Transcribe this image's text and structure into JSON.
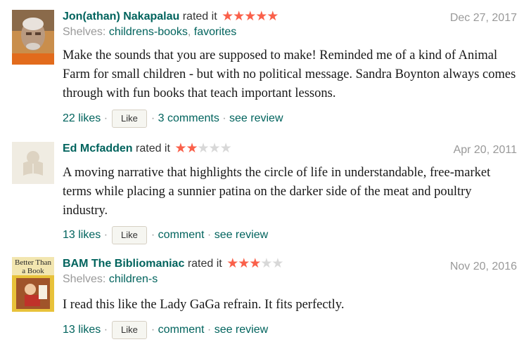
{
  "reviews": [
    {
      "user": "Jon(athan) Nakapalau",
      "rated_label": "rated it",
      "rating": 5,
      "date": "Dec 27, 2017",
      "shelves_label": "Shelves:",
      "shelves": [
        "childrens-books",
        "favorites"
      ],
      "text": "Make the sounds that you are supposed to make! Reminded me of a kind of Animal Farm for small children - but with no political message. Sandra Boynton always comes through with fun books that teach important lessons.",
      "likes": "22 likes",
      "like_button": "Like",
      "comments": "3 comments",
      "see_review": "see review"
    },
    {
      "user": "Ed Mcfadden",
      "rated_label": "rated it",
      "rating": 2,
      "date": "Apr 20, 2011",
      "text": "A moving narrative that highlights the circle of life in understandable, free-market terms while placing a sunnier patina on the darker side of the meat and poultry industry.",
      "likes": "13 likes",
      "like_button": "Like",
      "comments": "comment",
      "see_review": "see review"
    },
    {
      "user": "BAM The Bibliomaniac",
      "rated_label": "rated it",
      "rating": 3,
      "date": "Nov 20, 2016",
      "shelves_label": "Shelves:",
      "shelves": [
        "children-s"
      ],
      "avatar_text": "Better Than a Book",
      "text": "I read this like the Lady GaGa refrain. It fits perfectly.",
      "likes": "13 likes",
      "like_button": "Like",
      "comments": "comment",
      "see_review": "see review"
    }
  ],
  "colors": {
    "link": "#00635d",
    "star": "#fa604a",
    "muted": "#999999"
  }
}
